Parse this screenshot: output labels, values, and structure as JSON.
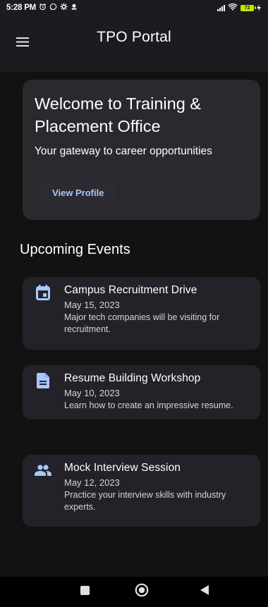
{
  "status_bar": {
    "time": "5:28 PM",
    "battery_level": "72"
  },
  "app_bar": {
    "title": "TPO Portal"
  },
  "welcome": {
    "title": "Welcome to Training & Placement Office",
    "subtitle": "Your gateway to career opportunities",
    "button_label": "View Profile"
  },
  "events_section": {
    "title": "Upcoming Events",
    "items": [
      {
        "icon": "calendar-icon",
        "title": "Campus Recruitment Drive",
        "date": "May 15, 2023",
        "description": "Major tech companies will be visiting for recruitment."
      },
      {
        "icon": "document-icon",
        "title": "Resume Building Workshop",
        "date": "May 10, 2023",
        "description": "Learn how to create an impressive resume."
      },
      {
        "icon": "people-icon",
        "title": "Mock Interview Session",
        "date": "May 12, 2023",
        "description": "Practice your interview skills with industry experts."
      }
    ]
  },
  "colors": {
    "background": "#121212",
    "card": "#2a292e",
    "accent": "#a8c7fa",
    "icon": "#a8c7fa"
  }
}
